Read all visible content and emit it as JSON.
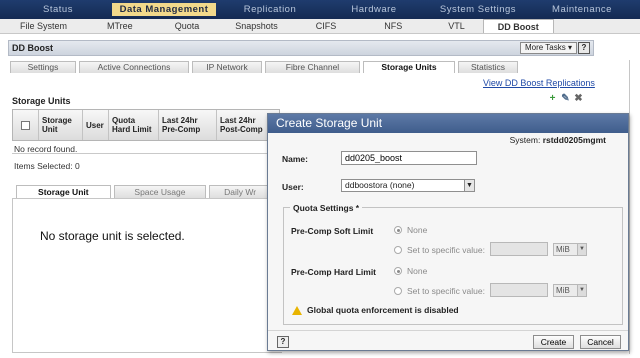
{
  "top_nav": {
    "tabs": [
      "Status",
      "Data Management",
      "Replication",
      "Hardware",
      "System Settings",
      "Maintenance"
    ],
    "active": "Data Management"
  },
  "sub_nav": {
    "tabs": [
      "File System",
      "MTree",
      "Quota",
      "Snapshots",
      "CIFS",
      "NFS",
      "VTL",
      "DD Boost"
    ],
    "active": "DD Boost"
  },
  "section": {
    "title": "DD Boost",
    "more_tasks": "More Tasks ▾",
    "help": "?"
  },
  "inner_tabs": {
    "tabs": [
      "Settings",
      "Active Connections",
      "IP Network",
      "Fibre Channel",
      "Storage Units",
      "Statistics"
    ],
    "active": "Storage Units"
  },
  "link_replications": "View DD Boost Replications",
  "toolbar_icons": [
    "add-icon",
    "edit-icon",
    "delete-icon"
  ],
  "storage_units": {
    "title": "Storage Units",
    "columns": [
      "Storage Unit",
      "User",
      "Quota Hard Limit",
      "Last 24hr Pre-Comp",
      "Last 24hr Post-Comp"
    ],
    "empty_text": "No record found.",
    "items_selected": "Items Selected: 0"
  },
  "detail": {
    "tabs": [
      "Storage Unit",
      "Space Usage",
      "Daily Wr"
    ],
    "active": "Storage Unit",
    "message": "No storage unit is selected."
  },
  "dialog": {
    "title": "Create Storage Unit",
    "system_label": "System:",
    "system_value": "rstdd0205mgmt",
    "name_label": "Name:",
    "name_value": "dd0205_boost",
    "user_label": "User:",
    "user_value": "ddboostora (none)",
    "quota_legend": "Quota Settings *",
    "soft_limit_label": "Pre-Comp Soft Limit",
    "hard_limit_label": "Pre-Comp Hard Limit",
    "none_option": "None",
    "specific_option": "Set to specific value:",
    "unit": "MiB",
    "warning": "Global quota enforcement is disabled",
    "help": "?",
    "create_label": "Create",
    "cancel_label": "Cancel"
  }
}
